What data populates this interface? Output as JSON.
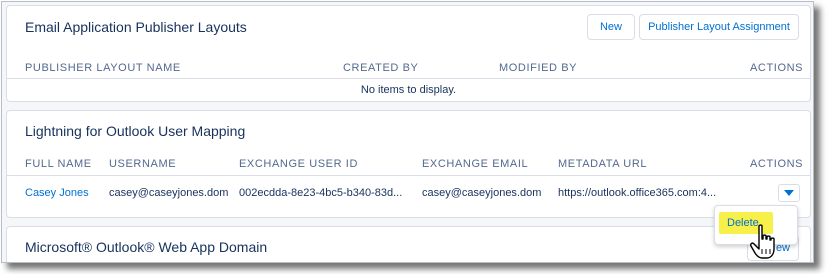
{
  "email_publisher": {
    "title": "Email Application Publisher Layouts",
    "new_button": "New",
    "assignment_button": "Publisher Layout Assignment",
    "columns": [
      "PUBLISHER LAYOUT NAME",
      "CREATED BY",
      "MODIFIED BY",
      "ACTIONS"
    ],
    "empty_message": "No items to display."
  },
  "user_mapping": {
    "title": "Lightning for Outlook User Mapping",
    "columns": [
      "FULL NAME",
      "USERNAME",
      "EXCHANGE USER ID",
      "EXCHANGE EMAIL",
      "METADATA URL",
      "ACTIONS"
    ],
    "rows": [
      {
        "full_name": "Casey Jones",
        "username": "casey@caseyjones.dom",
        "exchange_user_id": "002ecdda-8e23-4bc5-b340-83d...",
        "exchange_email": "casey@caseyjones.dom",
        "metadata_url": "https://outlook.office365.com:4..."
      }
    ],
    "row_actions_icon": "chevron-down-icon",
    "menu": {
      "delete_label": "Delete"
    }
  },
  "web_app_domain": {
    "title": "Microsoft® Outlook® Web App Domain",
    "button_partial": "ew"
  },
  "colors": {
    "link": "#0070d2",
    "header_text": "#54698d",
    "highlight": "#f7f04a",
    "background": "#f4f6f9"
  }
}
